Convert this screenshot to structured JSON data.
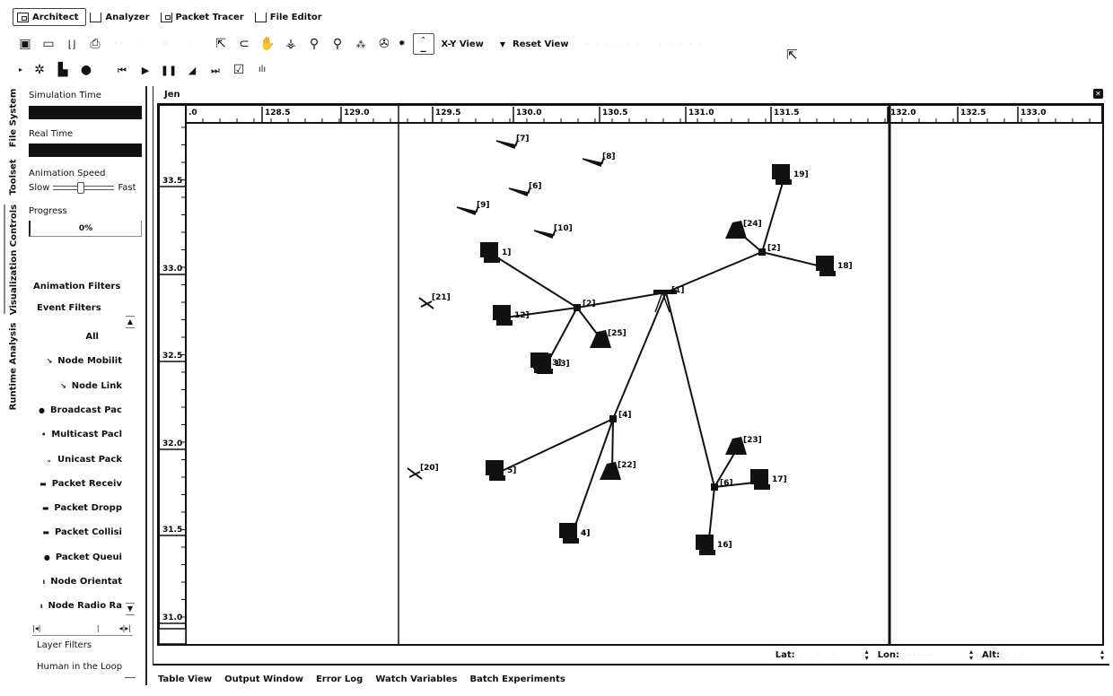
{
  "mode_tabs": [
    {
      "label": "Architect",
      "icon": "architect-icon",
      "active": true
    },
    {
      "label": "Analyzer",
      "icon": "analyzer-icon",
      "active": false
    },
    {
      "label": "Packet Tracer",
      "icon": "packet-tracer-icon",
      "active": false
    },
    {
      "label": "File Editor",
      "icon": "file-editor-icon",
      "active": false
    }
  ],
  "toolbar": {
    "icons": [
      "new-scenario-icon",
      "open-folder-icon",
      "save-icon",
      "print-icon",
      "undo-icon",
      "redo-icon",
      "cut-icon",
      "copy-icon",
      "select-arrow-icon",
      "lasso-icon",
      "pan-hand-icon",
      "rotate-icon",
      "zoom-icon",
      "zoom-area-icon",
      "node-icon",
      "satellite-icon"
    ],
    "view_label": "X-Y View",
    "reset_label": "Reset View"
  },
  "sim_toolbar": {
    "icons": [
      "expand-arrow-icon",
      "settings-gear-icon",
      "clapper-icon",
      "record-icon",
      "skip-back-icon",
      "play-icon",
      "pause-icon",
      "step-icon",
      "skip-forward-icon",
      "edit-icon",
      "stats-icon"
    ]
  },
  "vertical_tabs": [
    {
      "label": "File System",
      "active": false
    },
    {
      "label": "Toolset",
      "active": false
    },
    {
      "label": "Visualization Controls",
      "active": true
    },
    {
      "label": "Runtime Analysis",
      "active": false
    }
  ],
  "panel": {
    "simulation_time_label": "Simulation Time",
    "real_time_label": "Real Time",
    "animation_speed_label": "Animation Speed",
    "slow_label": "Slow",
    "fast_label": "Fast",
    "animation_speed_value": 0.45,
    "progress_label": "Progress",
    "progress_value": "0%",
    "animation_filters_label": "Animation Filters",
    "event_filters_label": "Event Filters",
    "event_filters": [
      {
        "label": "All",
        "bullet": ""
      },
      {
        "label": "Node Mobilit",
        "bullet": "↘"
      },
      {
        "label": "Node Link",
        "bullet": "↘"
      },
      {
        "label": "Broadcast Pac",
        "bullet": "●"
      },
      {
        "label": "Multicast Pacl",
        "bullet": "•"
      },
      {
        "label": "Unicast Pack",
        "bullet": "⌄"
      },
      {
        "label": "Packet Receiv",
        "bullet": "▬"
      },
      {
        "label": "Packet Dropp",
        "bullet": "▬"
      },
      {
        "label": "Packet Collisi",
        "bullet": "▬"
      },
      {
        "label": "Packet Queui",
        "bullet": "●"
      },
      {
        "label": "Node Orientat",
        "bullet": "ı"
      },
      {
        "label": "Node Radio Ra",
        "bullet": "ı"
      }
    ],
    "layer_filters_label": "Layer Filters",
    "human_in_loop_label": "Human in the Loop"
  },
  "canvas": {
    "title": "Jen",
    "x_ticks": [
      ".0",
      "128.5",
      "129.0",
      "129.5",
      "130.0",
      "130.5",
      "131.0",
      "131.5",
      "132.0",
      "132.5",
      "133.0"
    ],
    "y_ticks": [
      "33.5",
      "33.0",
      "32.5",
      "32.0",
      "31.5",
      "31.0"
    ],
    "nodes": [
      {
        "id": "1",
        "type": "computer",
        "label": "1]"
      },
      {
        "id": "2a",
        "type": "hub",
        "label": "[2]"
      },
      {
        "id": "2b",
        "type": "hub",
        "label": "[2]"
      },
      {
        "id": "3",
        "type": "computer",
        "label": "3]"
      },
      {
        "id": "4",
        "type": "hub",
        "label": "[4]"
      },
      {
        "id": "4b",
        "type": "computer",
        "label": "4]"
      },
      {
        "id": "5",
        "type": "computer",
        "label": "5]"
      },
      {
        "id": "6",
        "type": "hub",
        "label": "[6]"
      },
      {
        "id": "7",
        "type": "aircraft",
        "label": "[7]"
      },
      {
        "id": "8",
        "type": "aircraft",
        "label": "[8]"
      },
      {
        "id": "6b",
        "type": "aircraft-small",
        "label": "[6]"
      },
      {
        "id": "9",
        "type": "aircraft",
        "label": "[9]"
      },
      {
        "id": "10",
        "type": "aircraft",
        "label": "[10]"
      },
      {
        "id": "12",
        "type": "computer",
        "label": "12]"
      },
      {
        "id": "13",
        "type": "computer",
        "label": "13]"
      },
      {
        "id": "14",
        "type": "computer",
        "label": "4]"
      },
      {
        "id": "16",
        "type": "computer",
        "label": "16]"
      },
      {
        "id": "17",
        "type": "computer",
        "label": "17]"
      },
      {
        "id": "18",
        "type": "computer",
        "label": "18]"
      },
      {
        "id": "19",
        "type": "computer",
        "label": "19]"
      },
      {
        "id": "20",
        "type": "crossed",
        "label": "[20]"
      },
      {
        "id": "21",
        "type": "crossed",
        "label": "[21]"
      },
      {
        "id": "22",
        "type": "antenna",
        "label": "[22]"
      },
      {
        "id": "23",
        "type": "antenna",
        "label": "[23]"
      },
      {
        "id": "24",
        "type": "antenna",
        "label": "[24]"
      },
      {
        "id": "25",
        "type": "antenna",
        "label": "[25]"
      },
      {
        "id": "main",
        "type": "router",
        "label": "[1]"
      }
    ],
    "lat_label": "Lat:",
    "lon_label": "Lon:",
    "alt_label": "Alt:"
  },
  "bottom_tabs": [
    "Table View",
    "Output Window",
    "Error Log",
    "Watch Variables",
    "Batch Experiments"
  ]
}
